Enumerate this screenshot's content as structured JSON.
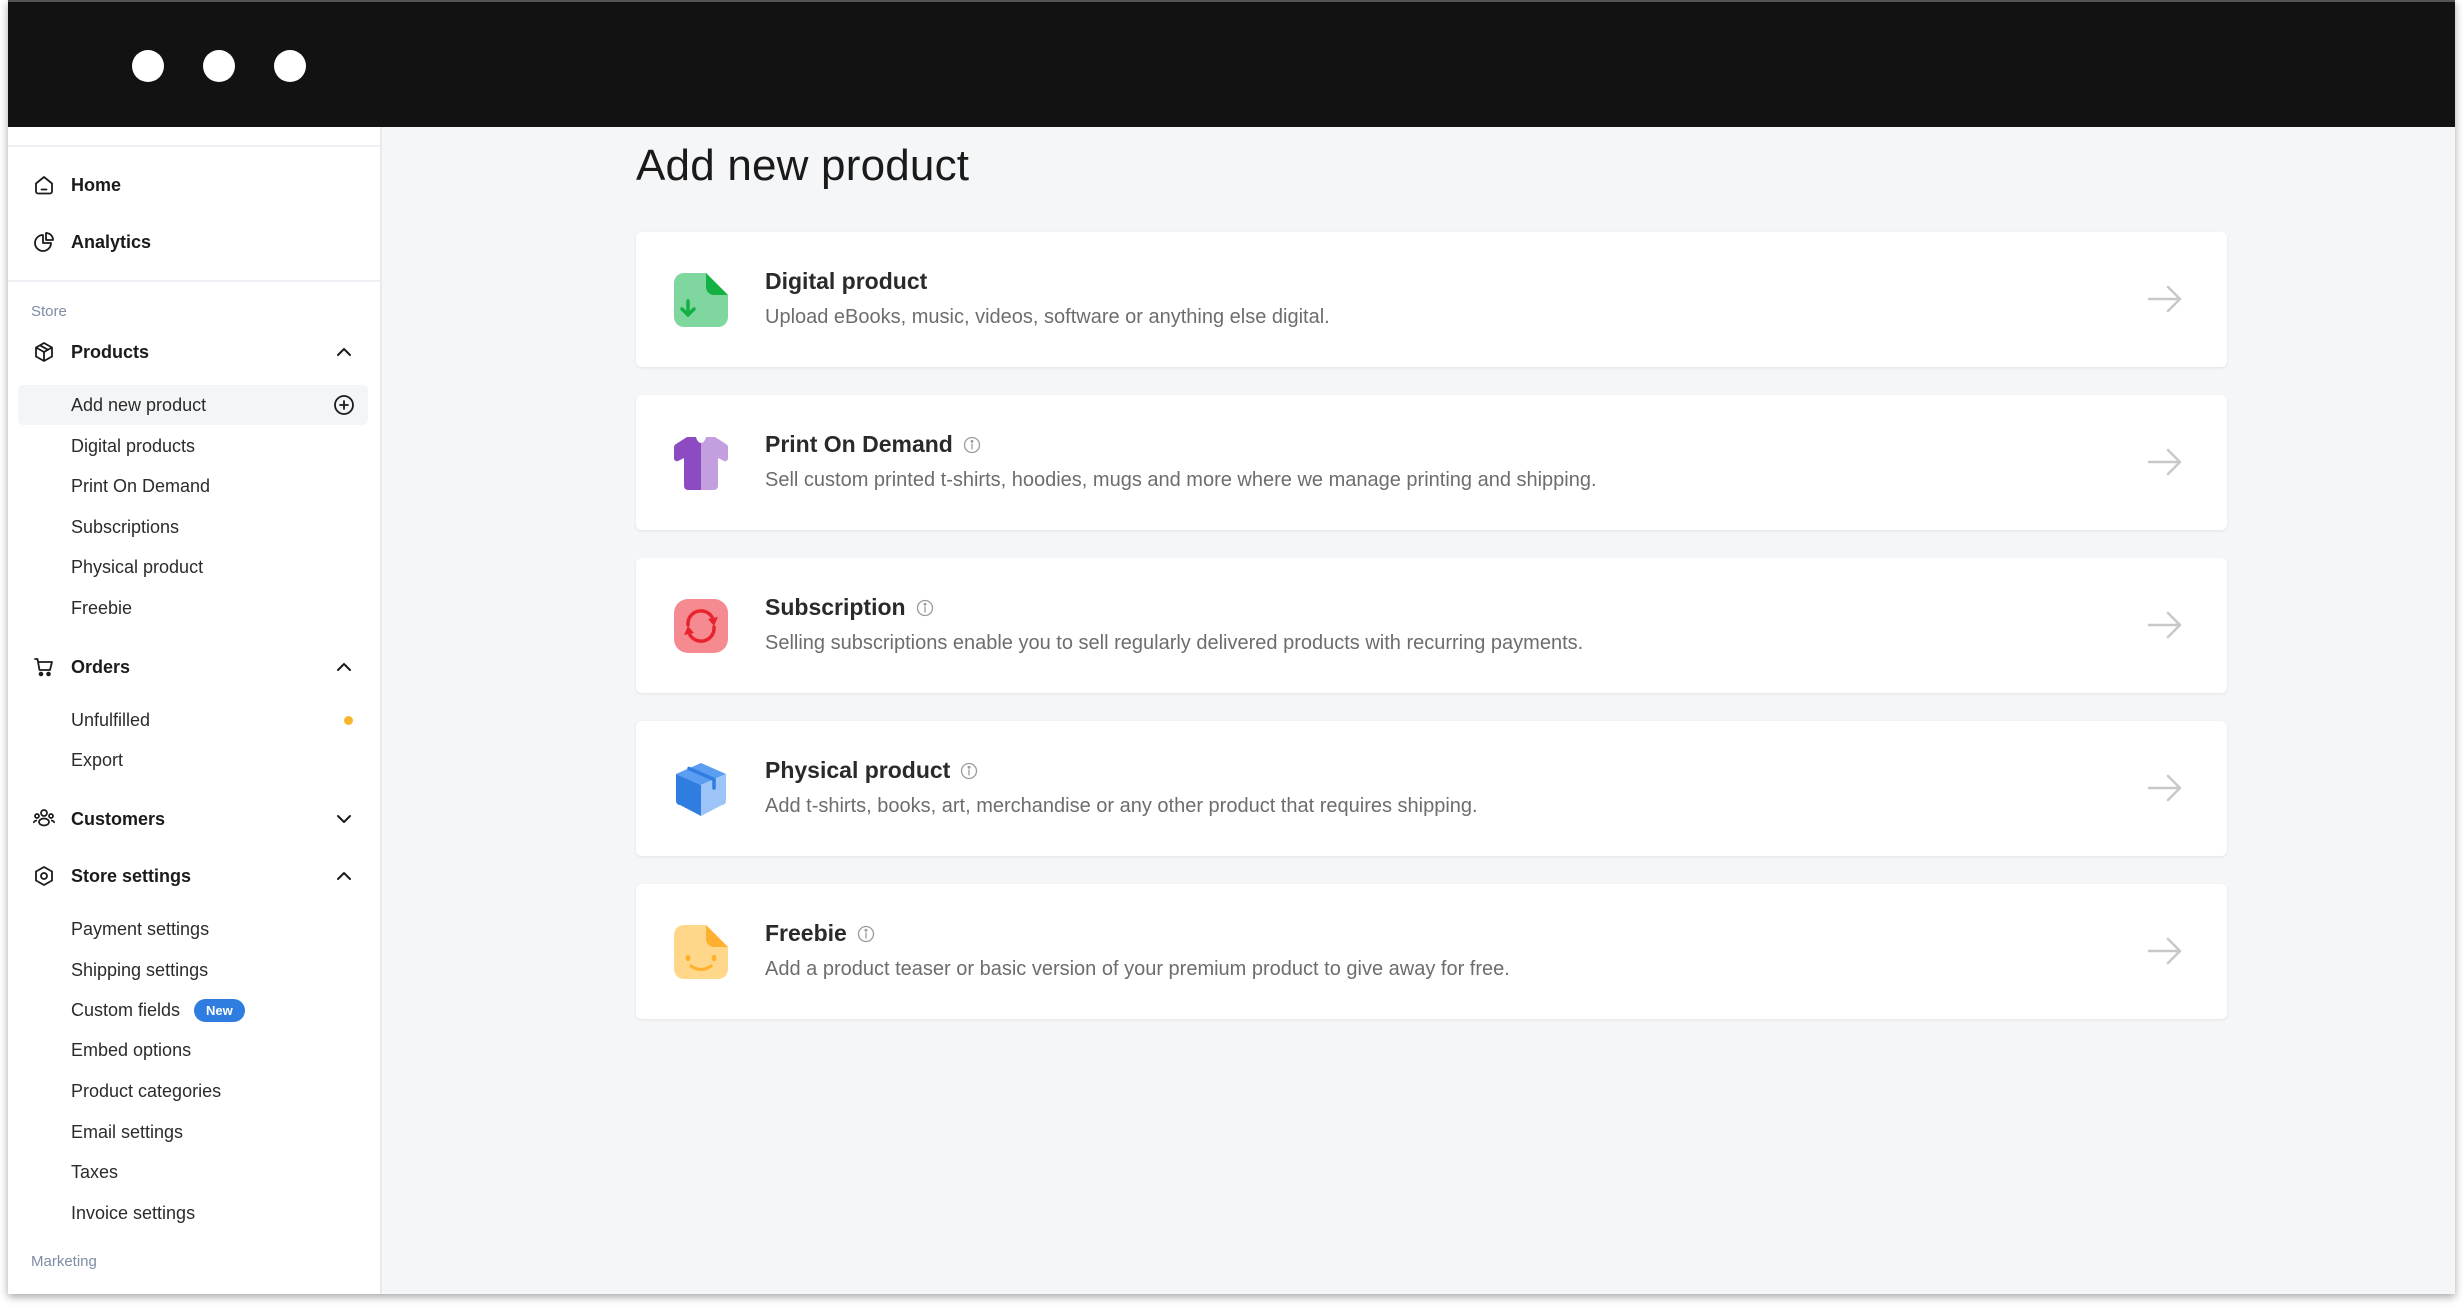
{
  "window": {
    "controls": [
      "dot",
      "dot",
      "dot"
    ]
  },
  "sidebar": {
    "top_items": [
      {
        "label": "Home",
        "icon": "home-icon"
      },
      {
        "label": "Analytics",
        "icon": "analytics-icon"
      }
    ],
    "store_section_label": "Store",
    "products": {
      "label": "Products",
      "icon": "box-icon",
      "expanded": true,
      "items": [
        {
          "label": "Add new product",
          "active": true,
          "trailing_icon": "plus-circle-icon"
        },
        {
          "label": "Digital products"
        },
        {
          "label": "Print On Demand"
        },
        {
          "label": "Subscriptions"
        },
        {
          "label": "Physical product"
        },
        {
          "label": "Freebie"
        }
      ]
    },
    "orders": {
      "label": "Orders",
      "icon": "cart-icon",
      "expanded": true,
      "items": [
        {
          "label": "Unfulfilled",
          "indicator": "orange-dot"
        },
        {
          "label": "Export"
        }
      ]
    },
    "customers": {
      "label": "Customers",
      "icon": "customers-icon",
      "expanded": false
    },
    "store_settings": {
      "label": "Store settings",
      "icon": "settings-icon",
      "expanded": true,
      "items": [
        {
          "label": "Payment settings"
        },
        {
          "label": "Shipping settings"
        },
        {
          "label": "Custom fields",
          "badge": "New"
        },
        {
          "label": "Embed options"
        },
        {
          "label": "Product categories"
        },
        {
          "label": "Email settings"
        },
        {
          "label": "Taxes"
        },
        {
          "label": "Invoice settings"
        }
      ]
    },
    "marketing_section_label": "Marketing"
  },
  "main": {
    "title": "Add new product",
    "cards": [
      {
        "title": "Digital product",
        "description": "Upload eBooks, music, videos, software or anything else digital.",
        "icon": "digital-file-icon",
        "info": false
      },
      {
        "title": "Print On Demand",
        "description": "Sell custom printed t-shirts, hoodies, mugs and more where we manage printing and shipping.",
        "icon": "tshirt-icon",
        "info": true
      },
      {
        "title": "Subscription",
        "description": "Selling subscriptions enable you to sell regularly delivered products with recurring payments.",
        "icon": "refresh-icon",
        "info": true
      },
      {
        "title": "Physical product",
        "description": "Add t-shirts, books, art, merchandise or any other product that requires shipping.",
        "icon": "package-icon",
        "info": true
      },
      {
        "title": "Freebie",
        "description": "Add a product teaser or basic version of your premium product to give away for free.",
        "icon": "freebie-icon",
        "info": true
      }
    ]
  },
  "colors": {
    "titlebar": "#121212",
    "page_bg": "#f5f6f8",
    "badge_blue": "#2f7de1",
    "indicator_orange": "#f7b52c",
    "section_label": "#7f8ca6"
  }
}
